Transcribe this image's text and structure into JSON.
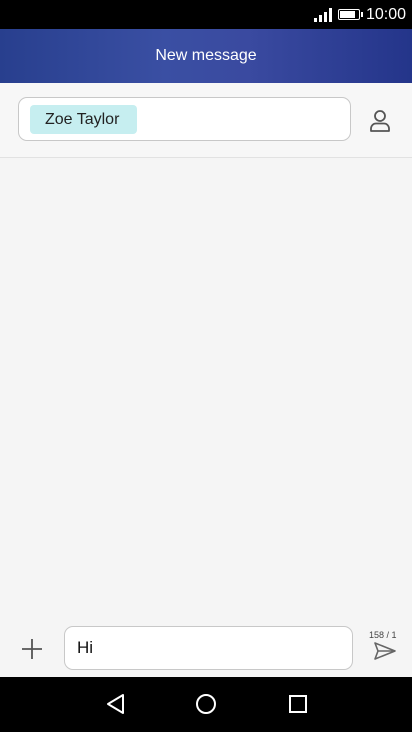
{
  "status_bar": {
    "time": "10:00",
    "signal_icon": "signal-icon",
    "battery_icon": "battery-icon",
    "battery_level": 0.9
  },
  "app_bar": {
    "title": "New message"
  },
  "recipients": {
    "chip_label": "Zoe Taylor",
    "contacts_icon": "person-icon"
  },
  "compose": {
    "message_text": "Hi",
    "char_counter": "158 / 1",
    "add_icon": "plus-icon",
    "send_icon": "send-icon"
  },
  "nav_bar": {
    "back_icon": "back-triangle-icon",
    "home_icon": "home-circle-icon",
    "recents_icon": "recents-square-icon"
  }
}
